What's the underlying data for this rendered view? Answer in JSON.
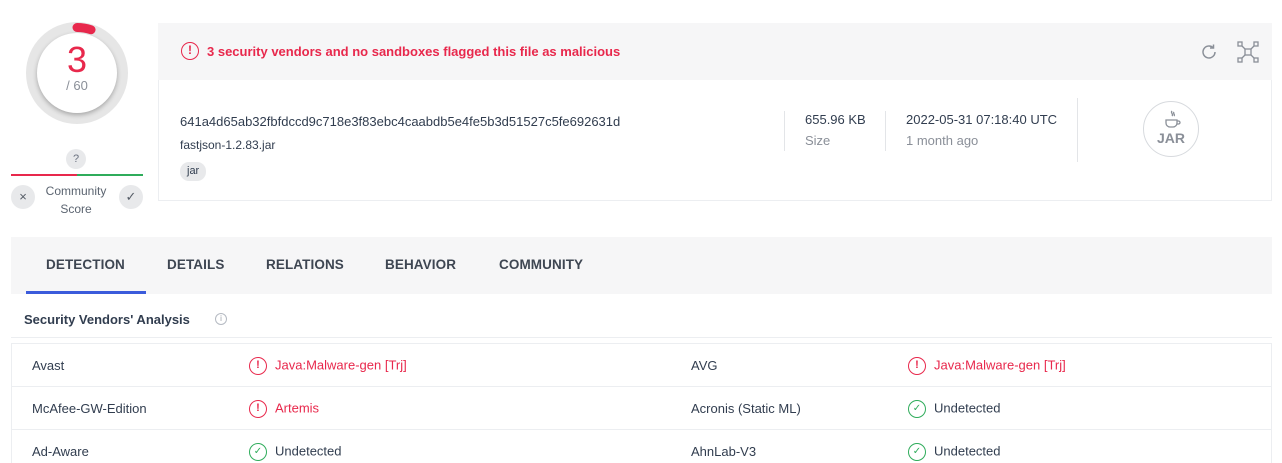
{
  "score": {
    "detections": "3",
    "total": "/ 60",
    "detections_count": 3,
    "engines_count": 60,
    "color": "#e8284c"
  },
  "community": {
    "unknown_symbol": "?",
    "label_line1": "Community",
    "label_line2": "Score",
    "downvote_symbol": "×",
    "upvote_symbol": "✓",
    "harmful_color": "#e8284c",
    "harmless_color": "#2fac5b"
  },
  "alert": {
    "icon": "alert-circle-icon",
    "text": "3 security vendors and no sandboxes flagged this file as malicious"
  },
  "toolbar": {
    "reanalyze_icon": "reanalyze-icon",
    "graph_icon": "graph-icon"
  },
  "file": {
    "hash": "641a4d65ab32fbfdccd9c718e3f83ebc4caabdb5e4fe5b3d51527c5fe692631d",
    "name": "fastjson-1.2.83.jar",
    "tag": "jar",
    "size": "655.96 KB",
    "size_label": "Size",
    "date": "2022-05-31 07:18:40 UTC",
    "date_relative": "1 month ago",
    "type_label": "JAR",
    "type_icon": "java-cup-icon"
  },
  "tabs": [
    {
      "label": "DETECTION",
      "active": true
    },
    {
      "label": "DETAILS",
      "active": false
    },
    {
      "label": "RELATIONS",
      "active": false
    },
    {
      "label": "BEHAVIOR",
      "active": false
    },
    {
      "label": "COMMUNITY",
      "active": false
    }
  ],
  "analysis": {
    "title": "Security Vendors' Analysis",
    "info_symbol": "i",
    "rows": [
      {
        "left": {
          "vendor": "Avast",
          "result": "Java:Malware-gen [Trj]",
          "malicious": true
        },
        "right": {
          "vendor": "AVG",
          "result": "Java:Malware-gen [Trj]",
          "malicious": true
        }
      },
      {
        "left": {
          "vendor": "McAfee-GW-Edition",
          "result": "Artemis",
          "malicious": true
        },
        "right": {
          "vendor": "Acronis (Static ML)",
          "result": "Undetected",
          "malicious": false
        }
      },
      {
        "left": {
          "vendor": "Ad-Aware",
          "result": "Undetected",
          "malicious": false
        },
        "right": {
          "vendor": "AhnLab-V3",
          "result": "Undetected",
          "malicious": false
        }
      }
    ]
  },
  "colors": {
    "malicious": "#e8284c",
    "clean": "#2fac5b",
    "accent": "#3b5bdb"
  }
}
